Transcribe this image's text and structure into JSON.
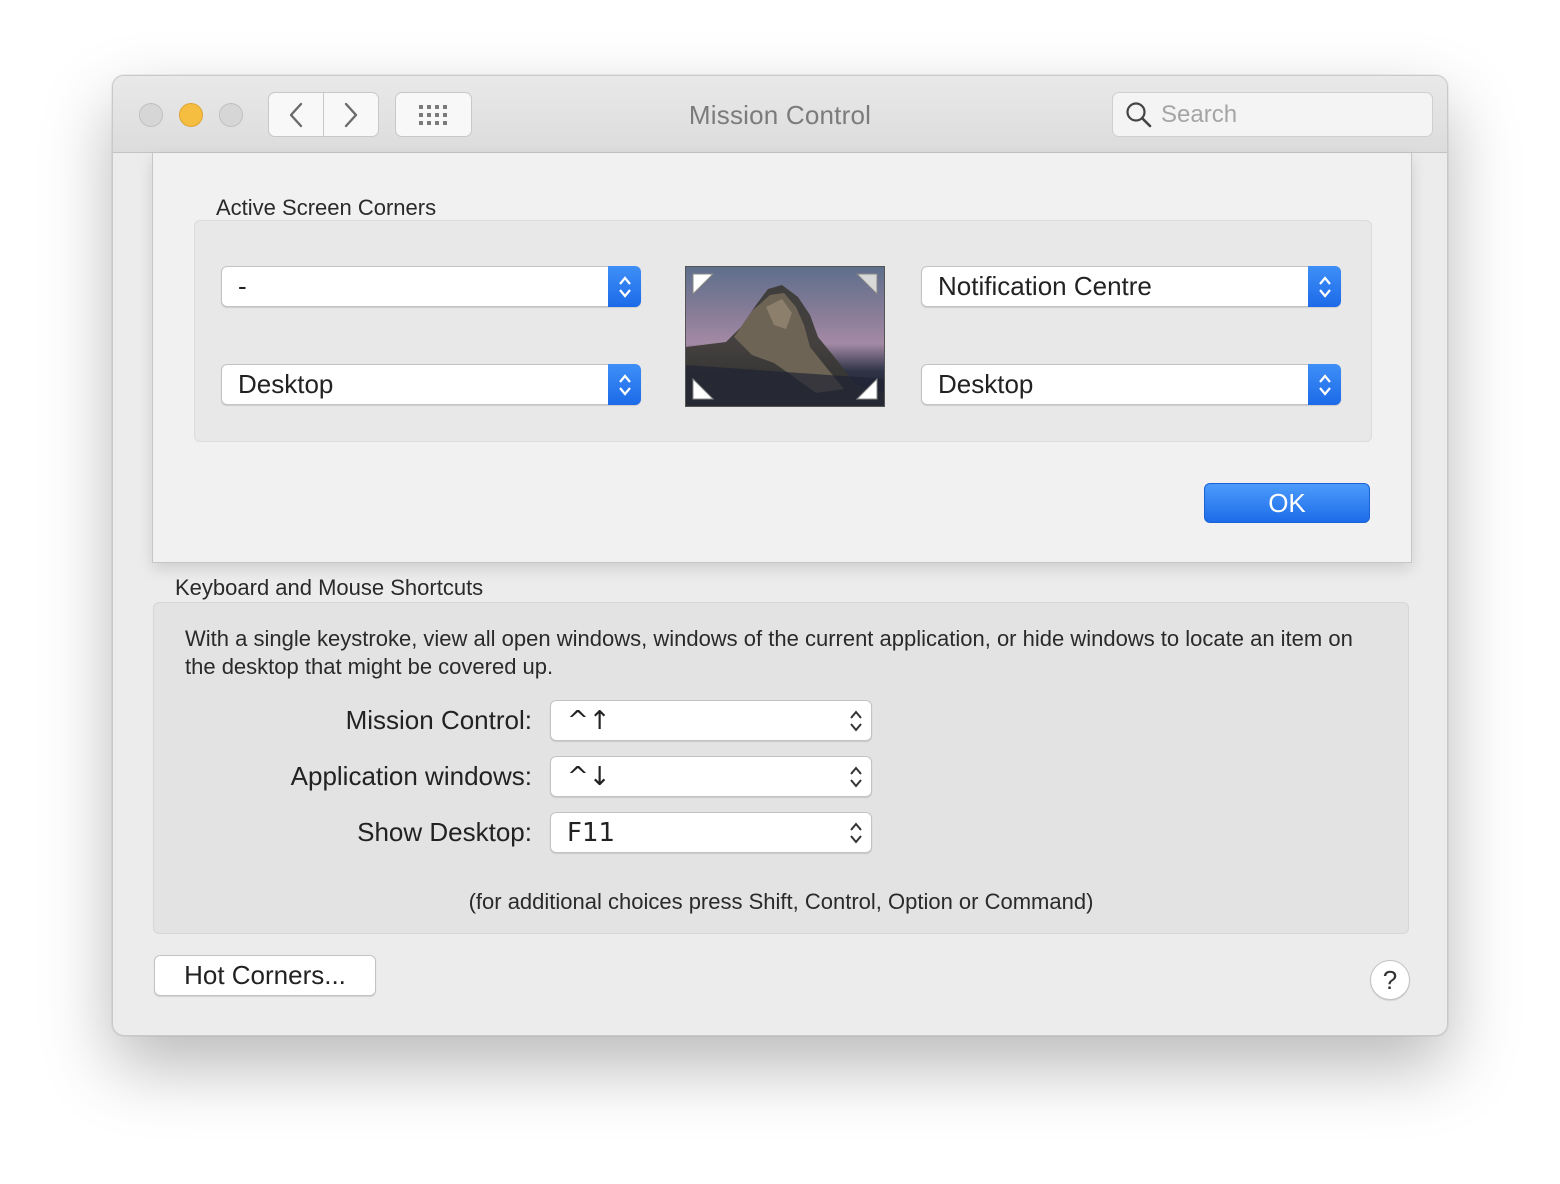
{
  "window": {
    "title": "Mission Control",
    "search_placeholder": "Search"
  },
  "toolbar": {
    "back_icon": "chevron-left-icon",
    "forward_icon": "chevron-right-icon",
    "grid_icon": "show-all-grid-icon"
  },
  "sheet": {
    "title": "Active Screen Corners",
    "corners": {
      "top_left": "-",
      "top_right": "Notification Centre",
      "bottom_left": "Desktop",
      "bottom_right": "Desktop"
    },
    "ok_label": "OK"
  },
  "shortcuts": {
    "title": "Keyboard and Mouse Shortcuts",
    "description": "With a single keystroke, view all open windows, windows of the current application, or hide windows to locate an item on the desktop that might be covered up.",
    "rows": [
      {
        "label": "Mission Control:",
        "value": "^↑"
      },
      {
        "label": "Application windows:",
        "value": "^↓"
      },
      {
        "label": "Show Desktop:",
        "value": "F11"
      }
    ],
    "note": "(for additional choices press Shift, Control, Option or Command)"
  },
  "footer": {
    "hot_corners_label": "Hot Corners...",
    "help_label": "?"
  },
  "colors": {
    "accent": "#1d6ce9",
    "minimize": "#f6be40"
  }
}
